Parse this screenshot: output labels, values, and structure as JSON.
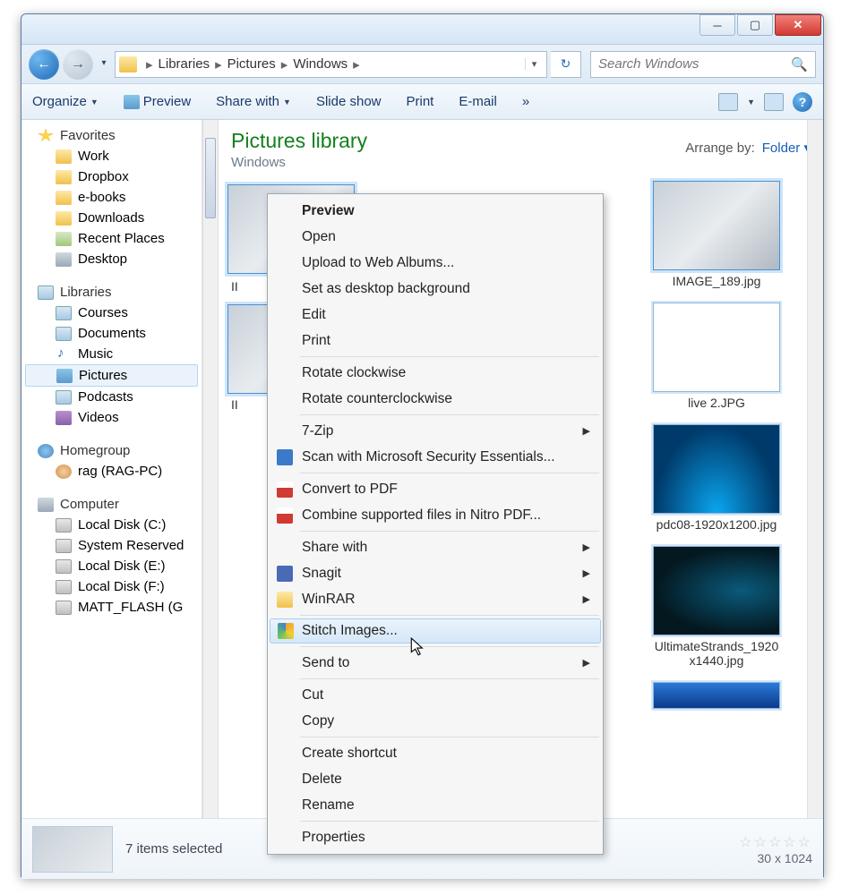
{
  "window": {
    "breadcrumb": [
      "Libraries",
      "Pictures",
      "Windows"
    ],
    "search_placeholder": "Search Windows"
  },
  "toolbar": {
    "organize": "Organize",
    "preview": "Preview",
    "share": "Share with",
    "slideshow": "Slide show",
    "print": "Print",
    "email": "E-mail",
    "more": "»"
  },
  "sidebar": {
    "favorites": {
      "label": "Favorites",
      "items": [
        "Work",
        "Dropbox",
        "e-books",
        "Downloads",
        "Recent Places",
        "Desktop"
      ]
    },
    "libraries": {
      "label": "Libraries",
      "items": [
        "Courses",
        "Documents",
        "Music",
        "Pictures",
        "Podcasts",
        "Videos"
      ],
      "selected": "Pictures"
    },
    "homegroup": {
      "label": "Homegroup",
      "items": [
        "rag (RAG-PC)"
      ]
    },
    "computer": {
      "label": "Computer",
      "items": [
        "Local Disk (C:)",
        "System Reserved",
        "Local Disk (E:)",
        "Local Disk (F:)",
        "MATT_FLASH (G"
      ]
    }
  },
  "main": {
    "title": "Pictures library",
    "subtitle": "Windows",
    "arrange_label": "Arrange by:",
    "arrange_value": "Folder",
    "right_items": [
      {
        "name": "IMAGE_189.jpg",
        "style": "sel"
      },
      {
        "name": "live 2.JPG",
        "style": "live"
      },
      {
        "name": "pdc08-1920x1200.jpg",
        "style": "pdc"
      },
      {
        "name": "UltimateStrands_1920x1440.jpg",
        "style": "ult"
      }
    ]
  },
  "details": {
    "status": "7 items selected",
    "dim": "30 x 1024"
  },
  "context_menu": [
    {
      "label": "Preview",
      "bold": true
    },
    {
      "label": "Open"
    },
    {
      "label": "Upload to Web Albums..."
    },
    {
      "label": "Set as desktop background"
    },
    {
      "label": "Edit"
    },
    {
      "label": "Print"
    },
    {
      "sep": true
    },
    {
      "label": "Rotate clockwise"
    },
    {
      "label": "Rotate counterclockwise"
    },
    {
      "sep": true
    },
    {
      "label": "7-Zip",
      "sub": true
    },
    {
      "label": "Scan with Microsoft Security Essentials...",
      "icon": "blue"
    },
    {
      "sep": true
    },
    {
      "label": "Convert to PDF",
      "icon": "red"
    },
    {
      "label": "Combine supported files in Nitro PDF...",
      "icon": "red"
    },
    {
      "sep": true
    },
    {
      "label": "Share with",
      "sub": true
    },
    {
      "label": "Snagit",
      "sub": true,
      "icon": "snag"
    },
    {
      "label": "WinRAR",
      "sub": true,
      "icon": "fold"
    },
    {
      "sep": true
    },
    {
      "label": "Stitch Images...",
      "icon": "st",
      "hover": true
    },
    {
      "sep": true
    },
    {
      "label": "Send to",
      "sub": true
    },
    {
      "sep": true
    },
    {
      "label": "Cut"
    },
    {
      "label": "Copy"
    },
    {
      "sep": true
    },
    {
      "label": "Create shortcut"
    },
    {
      "label": "Delete"
    },
    {
      "label": "Rename"
    },
    {
      "sep": true
    },
    {
      "label": "Properties"
    }
  ]
}
